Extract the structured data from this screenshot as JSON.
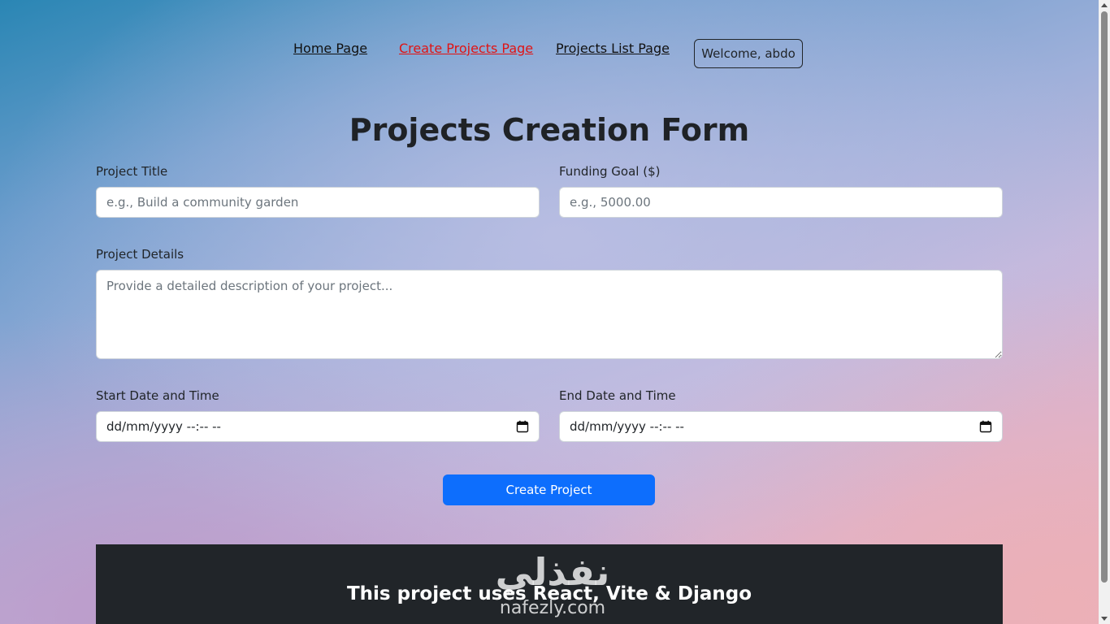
{
  "nav": {
    "home": "Home Page",
    "create": "Create Projects Page",
    "list": "Projects List Page",
    "welcome": "Welcome, abdo"
  },
  "page_title": "Projects Creation Form",
  "form": {
    "title_label": "Project Title",
    "title_placeholder": "e.g., Build a community garden",
    "goal_label": "Funding Goal ($)",
    "goal_placeholder": "e.g., 5000.00",
    "details_label": "Project Details",
    "details_placeholder": "Provide a detailed description of your project...",
    "start_label": "Start Date and Time",
    "start_value": "dd/mm/yyyy --:-- --",
    "end_label": "End Date and Time",
    "end_value": "dd/mm/yyyy --:-- --",
    "submit_label": "Create Project"
  },
  "footer": {
    "text": "This project uses React, Vite & Django"
  },
  "watermark": {
    "arabic": "نفذلي",
    "latin": "nafezly.com"
  },
  "colors": {
    "active_link": "#e01414",
    "primary_button": "#0d6efd",
    "footer_bg": "#212529"
  },
  "icons": {
    "date_picker": "calendar-icon"
  }
}
